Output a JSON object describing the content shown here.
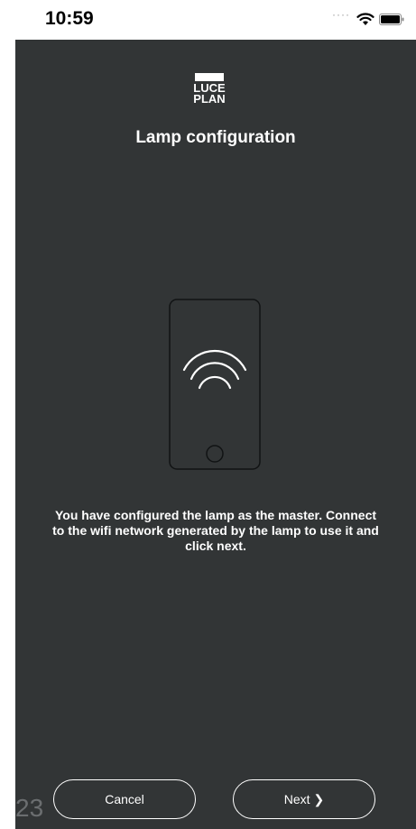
{
  "status_bar": {
    "time": "10:59",
    "signal": "····",
    "wifi_icon": "wifi-icon",
    "battery_icon": "battery-icon"
  },
  "logo": {
    "line1": "LUCE",
    "line2": "PLAN"
  },
  "title": "Lamp configuration",
  "illustration": {
    "icon": "phone-wifi-icon"
  },
  "message": "You have configured the lamp as the master. Connect to the wifi network generated by the lamp to use it and click next.",
  "buttons": {
    "cancel_label": "Cancel",
    "next_label": "Next",
    "next_icon": "chevron-right-icon"
  },
  "corner_number": "23",
  "colors": {
    "background": "#323536",
    "foreground": "#ffffff"
  }
}
